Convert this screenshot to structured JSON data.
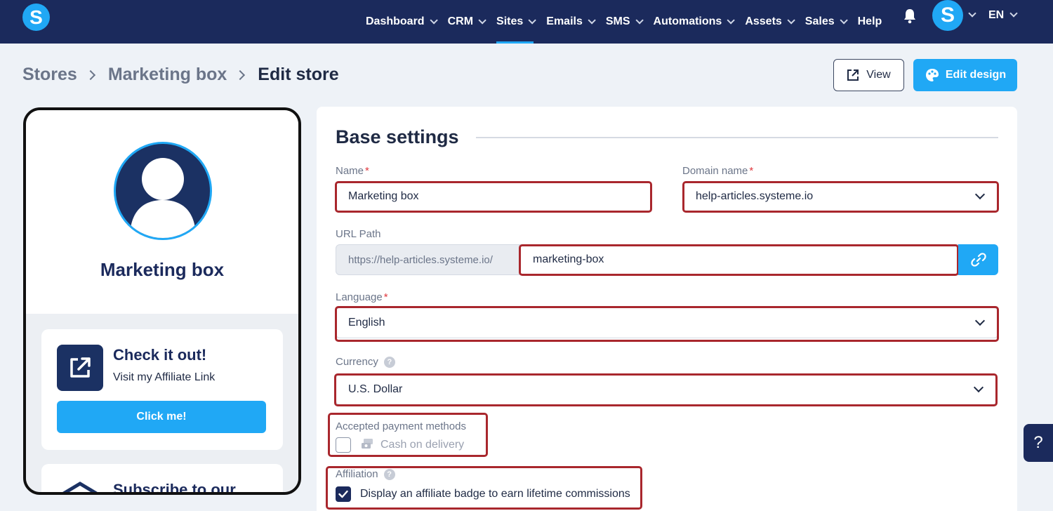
{
  "nav": {
    "logo": "S",
    "items": [
      {
        "label": "Dashboard",
        "dropdown": true
      },
      {
        "label": "CRM",
        "dropdown": true
      },
      {
        "label": "Sites",
        "dropdown": true,
        "active": true
      },
      {
        "label": "Emails",
        "dropdown": true
      },
      {
        "label": "SMS",
        "dropdown": true
      },
      {
        "label": "Automations",
        "dropdown": true
      },
      {
        "label": "Assets",
        "dropdown": true
      },
      {
        "label": "Sales",
        "dropdown": true
      },
      {
        "label": "Help",
        "dropdown": false
      }
    ],
    "avatar": "S",
    "language": "EN"
  },
  "breadcrumb": [
    "Stores",
    "Marketing box",
    "Edit store"
  ],
  "actions": {
    "view": "View",
    "edit_design": "Edit design"
  },
  "preview": {
    "name": "Marketing box",
    "card": {
      "title": "Check it out!",
      "subtitle": "Visit my Affiliate Link",
      "button": "Click me!"
    },
    "card2_title": "Subscribe to our"
  },
  "settings": {
    "title": "Base settings",
    "name": {
      "label": "Name",
      "required": "*",
      "value": "Marketing box"
    },
    "domain": {
      "label": "Domain name",
      "required": "*",
      "value": "help-articles.systeme.io"
    },
    "url": {
      "label": "URL Path",
      "prefix": "https://help-articles.systeme.io/",
      "value": "marketing-box"
    },
    "language": {
      "label": "Language",
      "required": "*",
      "value": "English"
    },
    "currency": {
      "label": "Currency",
      "value": "U.S. Dollar",
      "help": "?"
    },
    "payment": {
      "label": "Accepted payment methods",
      "option": "Cash on delivery",
      "checked": false
    },
    "affiliation": {
      "label": "Affiliation",
      "help": "?",
      "option": "Display an affiliate badge to earn lifetime commissions",
      "checked": true
    }
  },
  "help_tab": "?",
  "colors": {
    "nav_bg": "#1b2a5c",
    "accent": "#20a8f5",
    "highlight": "#a9272d"
  }
}
